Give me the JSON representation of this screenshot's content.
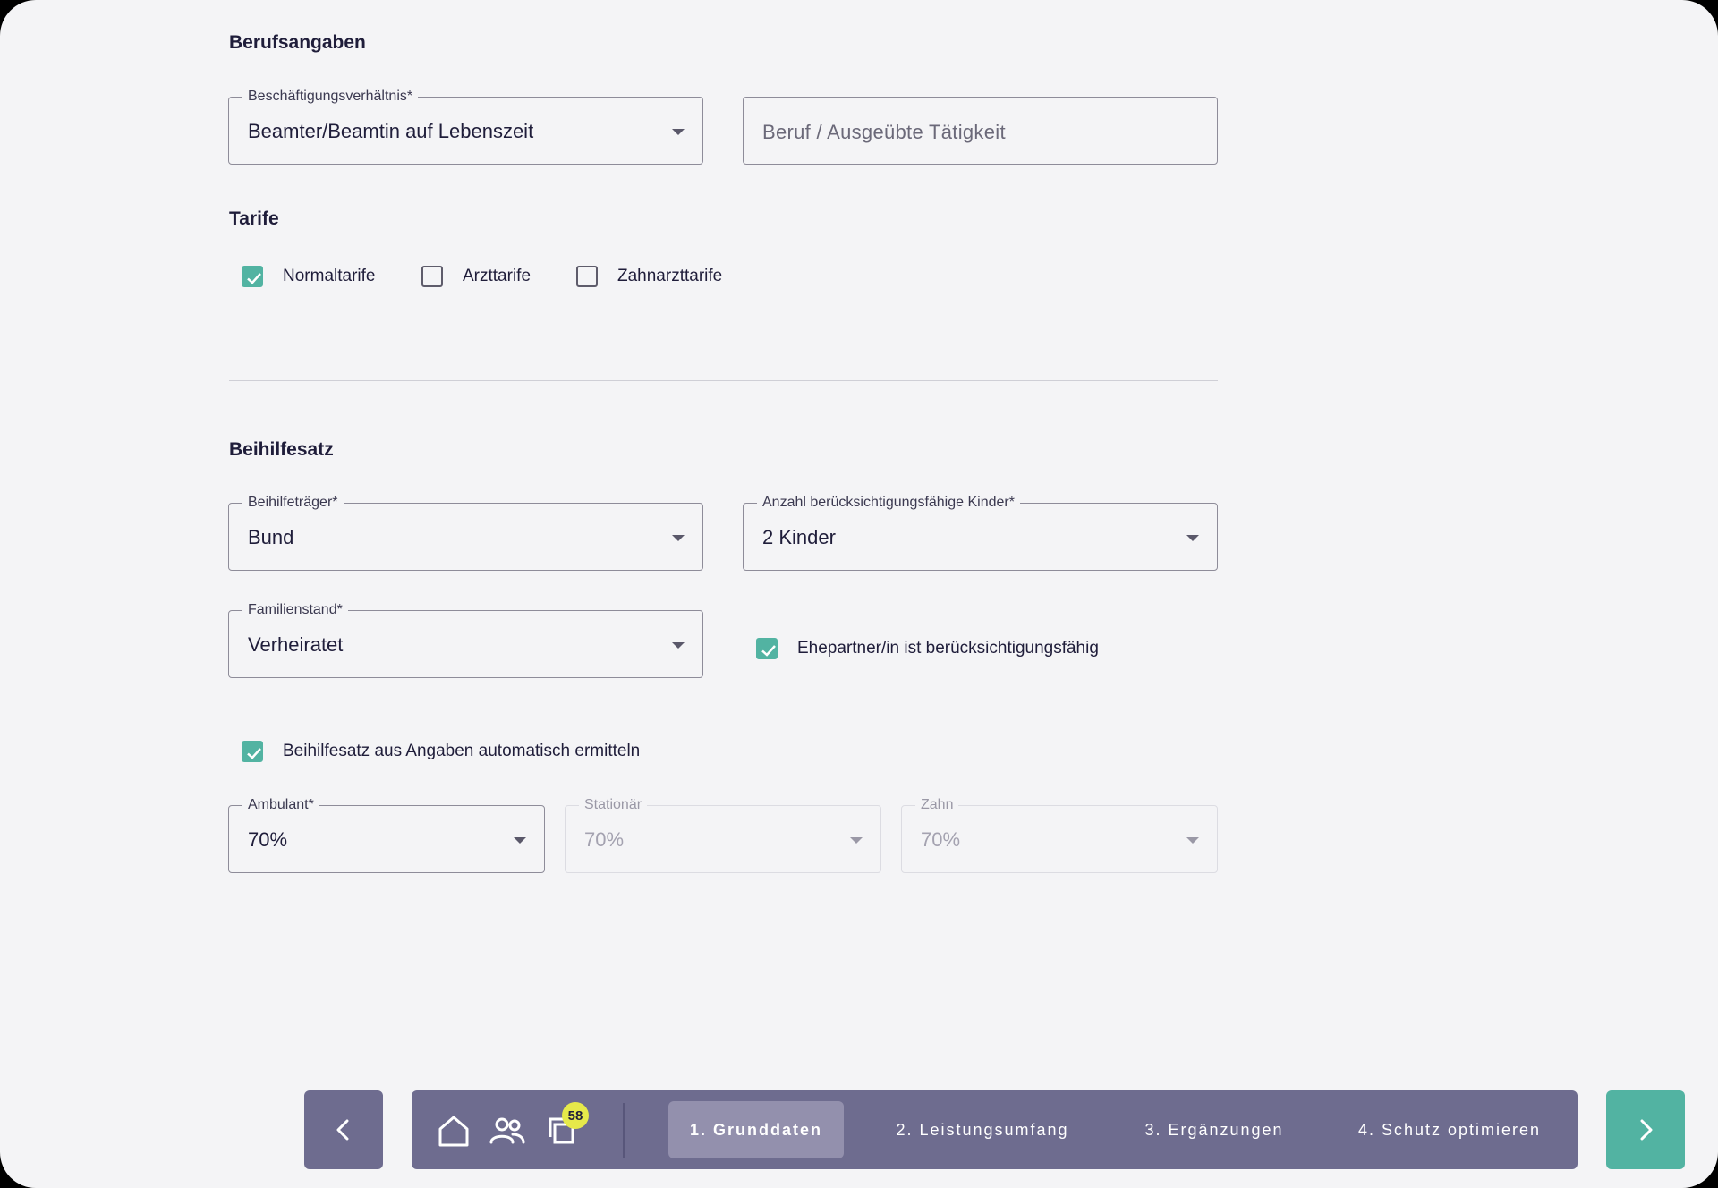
{
  "berufsangaben": {
    "title": "Berufsangaben",
    "employment_label": "Beschäftigungsverhältnis*",
    "employment_value": "Beamter/Beamtin auf Lebenszeit",
    "occupation_placeholder": "Beruf / Ausgeübte Tätigkeit"
  },
  "tarife": {
    "title": "Tarife",
    "options": [
      {
        "label": "Normaltarife",
        "checked": true
      },
      {
        "label": "Arzttarife",
        "checked": false
      },
      {
        "label": "Zahnarzttarife",
        "checked": false
      }
    ]
  },
  "beihilfesatz": {
    "title": "Beihilfesatz",
    "traeger_label": "Beihilfeträger*",
    "traeger_value": "Bund",
    "kinder_label": "Anzahl berücksichtigungsfähige Kinder*",
    "kinder_value": "2 Kinder",
    "familienstand_label": "Familienstand*",
    "familienstand_value": "Verheiratet",
    "ehepartner_label": "Ehepartner/in ist berücksichtigungsfähig",
    "ehepartner_checked": true,
    "auto_label": "Beihilfesatz aus Angaben automatisch ermitteln",
    "auto_checked": true,
    "ambulant_label": "Ambulant*",
    "ambulant_value": "70%",
    "stationaer_label": "Stationär",
    "stationaer_value": "70%",
    "zahn_label": "Zahn",
    "zahn_value": "70%"
  },
  "bottom_bar": {
    "badge_count": "58",
    "steps": [
      {
        "label": "1. Grunddaten",
        "active": true
      },
      {
        "label": "2. Leistungsumfang",
        "active": false
      },
      {
        "label": "3. Ergänzungen",
        "active": false
      },
      {
        "label": "4. Schutz optimieren",
        "active": false
      }
    ]
  },
  "colors": {
    "accent": "#52b3a2",
    "nav_bar": "#6e6c8f",
    "badge": "#e6e94a",
    "background": "#f4f4f6"
  },
  "icons": [
    "chevron-left-icon",
    "home-icon",
    "users-icon",
    "copy-icon",
    "chevron-right-icon",
    "check-icon",
    "caret-down-icon"
  ]
}
